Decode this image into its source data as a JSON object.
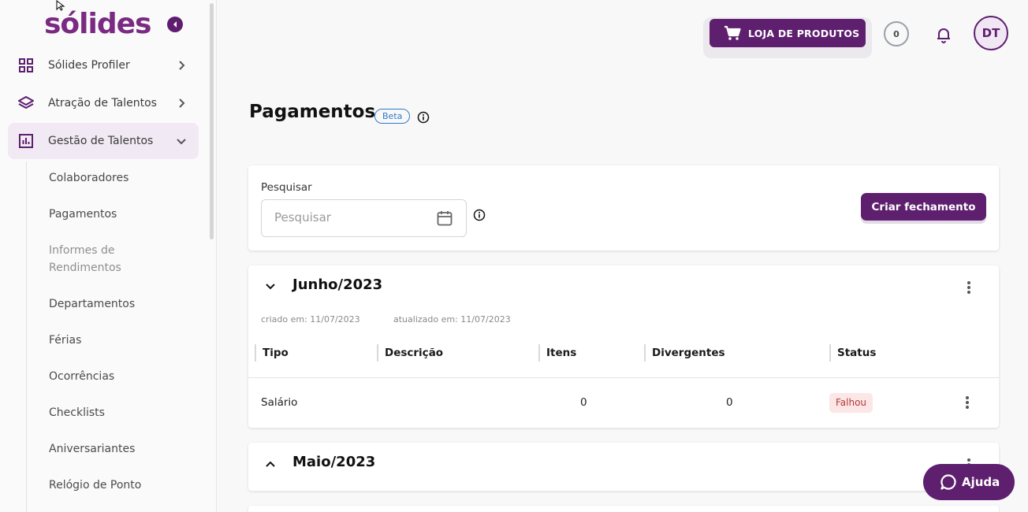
{
  "brand": {
    "logo_text": "sólides",
    "accent": "#5d1f6e"
  },
  "sidebar": {
    "main_items": [
      {
        "label": "Sólides Profiler",
        "icon": "grid-icon",
        "expanded": false
      },
      {
        "label": "Atração de Talentos",
        "icon": "layers-icon",
        "expanded": false
      },
      {
        "label": "Gestão de Talentos",
        "icon": "chart-icon",
        "expanded": true
      }
    ],
    "sub_items": [
      {
        "label": "Colaboradores",
        "muted": false
      },
      {
        "label": "Pagamentos",
        "muted": false
      },
      {
        "label": "Informes de Rendimentos",
        "muted": true
      },
      {
        "label": "Departamentos",
        "muted": false
      },
      {
        "label": "Férias",
        "muted": false
      },
      {
        "label": "Ocorrências",
        "muted": false
      },
      {
        "label": "Checklists",
        "muted": false
      },
      {
        "label": "Aniversariantes",
        "muted": false
      },
      {
        "label": "Relógio de Ponto",
        "muted": false
      }
    ]
  },
  "header": {
    "store_label": "LOJA DE PRODUTOS",
    "counter": "0",
    "avatar_initials": "DT"
  },
  "page": {
    "title": "Pagamentos",
    "badge": "Beta"
  },
  "filter": {
    "label": "Pesquisar",
    "placeholder": "Pesquisar",
    "create_label": "Criar fechamento"
  },
  "months": [
    {
      "title": "Junho/2023",
      "created": "criado em: 11/07/2023",
      "updated": "atualizado em: 11/07/2023",
      "columns": [
        "Tipo",
        "Descrição",
        "Itens",
        "Divergentes",
        "Status"
      ],
      "rows": [
        {
          "tipo": "Salário",
          "descricao": "",
          "itens": "0",
          "divergentes": "0",
          "status": "Falhou"
        }
      ]
    },
    {
      "title": "Maio/2023"
    }
  ],
  "help": {
    "label": "Ajuda"
  }
}
